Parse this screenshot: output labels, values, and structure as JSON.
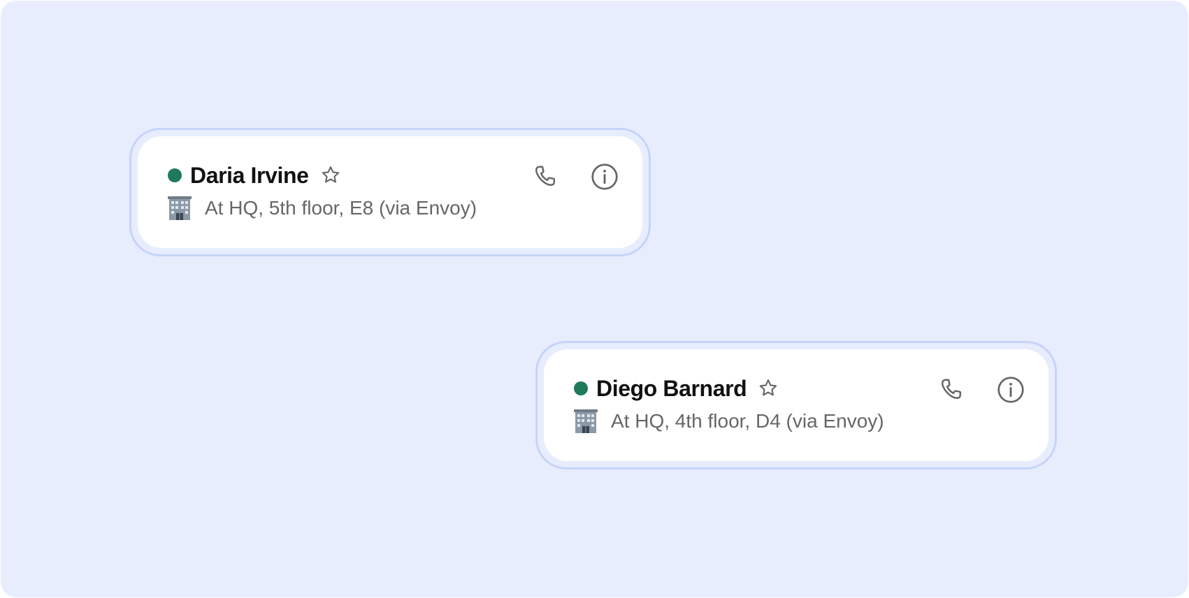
{
  "contacts": [
    {
      "name": "Daria Irvine",
      "presence_color": "#1f7a5a",
      "status_icon": "office-building-icon",
      "status": "At HQ, 5th floor, E8 (via Envoy)",
      "favorite_icon": "star-outline-icon",
      "actions": [
        "phone-icon",
        "info-icon"
      ]
    },
    {
      "name": "Diego Barnard",
      "presence_color": "#1f7a5a",
      "status_icon": "office-building-icon",
      "status": "At HQ, 4th floor, D4 (via Envoy)",
      "favorite_icon": "star-outline-icon",
      "actions": [
        "phone-icon",
        "info-icon"
      ]
    }
  ],
  "colors": {
    "background": "#e8edfe",
    "card_border": "#c6d3fb",
    "card": "#ffffff",
    "presence_online": "#1f7a5a",
    "icon": "#666666"
  }
}
